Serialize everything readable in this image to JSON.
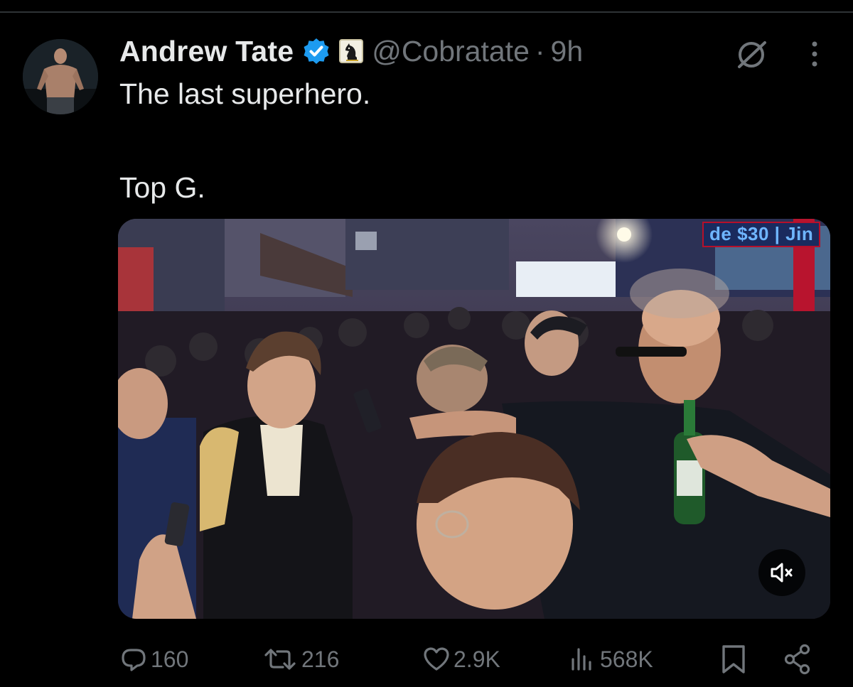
{
  "tweet": {
    "author": {
      "display_name": "Andrew Tate",
      "handle": "@Cobratate",
      "verified": true,
      "affiliate_badge_icon": "chess-knight-icon"
    },
    "timestamp": "9h",
    "separator": "·",
    "text_line1": "The last superhero.",
    "text_line2": "Top G.",
    "media": {
      "type": "video",
      "sign_text": "de $30 | Jin",
      "muted": true
    },
    "actions": {
      "replies": "160",
      "reposts": "216",
      "likes": "2.9K",
      "views": "568K"
    }
  },
  "colors": {
    "background": "#000000",
    "text_primary": "#e7e9ea",
    "text_secondary": "#71767b",
    "verified_blue": "#1d9bf0",
    "divider": "#2f3336"
  }
}
